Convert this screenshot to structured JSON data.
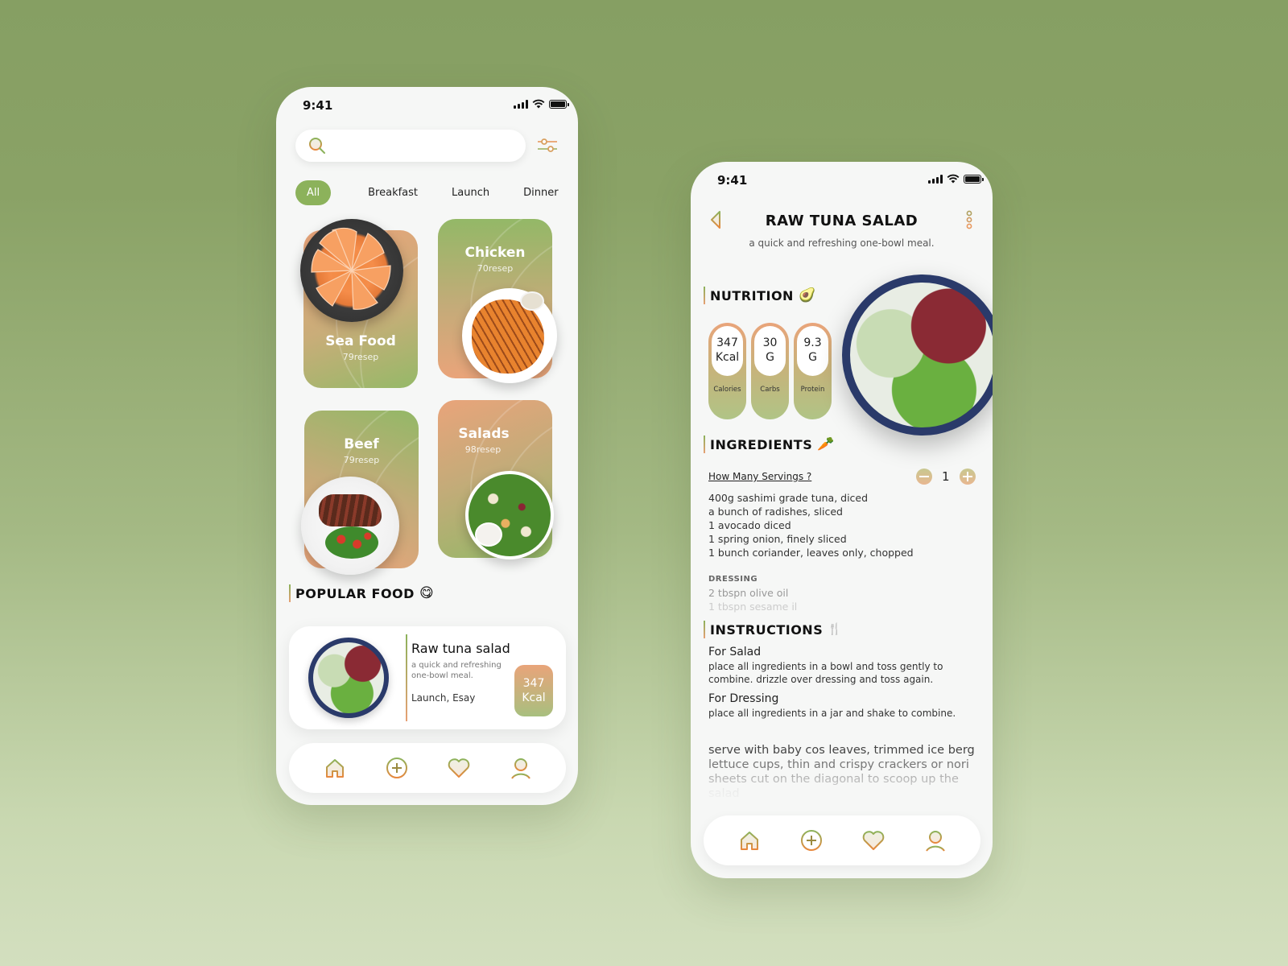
{
  "colors": {
    "accent_green": "#8cb25b",
    "accent_orange": "#e9a47a",
    "background_top": "#869f63",
    "background_bottom": "#d3dfbf"
  },
  "home_screen": {
    "status_bar": {
      "time": "9:41"
    },
    "search": {
      "placeholder": "",
      "value": "",
      "icon": "search-icon"
    },
    "filter_icon": "sliders-icon",
    "tabs": [
      {
        "label": "All",
        "active": true
      },
      {
        "label": "Breakfast",
        "active": false
      },
      {
        "label": "Launch",
        "active": false
      },
      {
        "label": "Dinner",
        "active": false
      }
    ],
    "categories": [
      {
        "title": "Sea Food",
        "subtitle": "79resep"
      },
      {
        "title": "Chicken",
        "subtitle": "70resep"
      },
      {
        "title": "Beef",
        "subtitle": "79resep"
      },
      {
        "title": "Salads",
        "subtitle": "98resep"
      }
    ],
    "popular": {
      "heading": "POPULAR FOOD",
      "emoji": "😋",
      "item": {
        "title": "Raw tuna salad",
        "description": " a quick and refreshing one-bowl meal.",
        "tags": "Launch, Esay",
        "kcal_value": "347",
        "kcal_unit": "Kcal"
      }
    },
    "nav": [
      "home-icon",
      "add-icon",
      "heart-icon",
      "profile-icon"
    ]
  },
  "detail_screen": {
    "status_bar": {
      "time": "9:41"
    },
    "title": "RAW TUNA SALAD",
    "subtitle": "a quick and refreshing one-bowl meal.",
    "nutrition": {
      "heading": "NUTRITION",
      "emoji": "🥑",
      "items": [
        {
          "value": "347",
          "unit": "Kcal",
          "label": "Calories"
        },
        {
          "value": "30",
          "unit": "G",
          "label": "Carbs"
        },
        {
          "value": "9.3",
          "unit": "G",
          "label": "Protein"
        }
      ]
    },
    "ingredients": {
      "heading": "INGREDIENTS",
      "emoji": "🥕",
      "servings_label": "How Many Servings ?",
      "servings_value": "1",
      "items": [
        "400g sashimi grade tuna, diced",
        "a bunch of radishes, sliced",
        "1 avocado diced",
        "1 spring onion, finely sliced",
        "1 bunch coriander, leaves only, chopped"
      ],
      "dressing_heading": "DRESSING",
      "dressing_items": [
        "2 tbspn olive oil",
        "1 tbspn sesame il"
      ]
    },
    "instructions": {
      "heading": "INSTRUCTIONS",
      "emoji": "🍴",
      "steps": [
        {
          "title": "For Salad",
          "text": "place all ingredients in a bowl and toss gently to combine. drizzle over dressing and toss again."
        },
        {
          "title": "For Dressing",
          "text": "place all ingredients in a jar and shake to combine."
        }
      ],
      "serve_lines": [
        "serve with baby cos leaves, trimmed ice berg",
        "lettuce cups, thin and crispy crackers or nori",
        "sheets cut on the diagonal to scoop up the",
        "salad"
      ]
    },
    "nav": [
      "home-icon",
      "add-icon",
      "heart-icon",
      "profile-icon"
    ]
  }
}
